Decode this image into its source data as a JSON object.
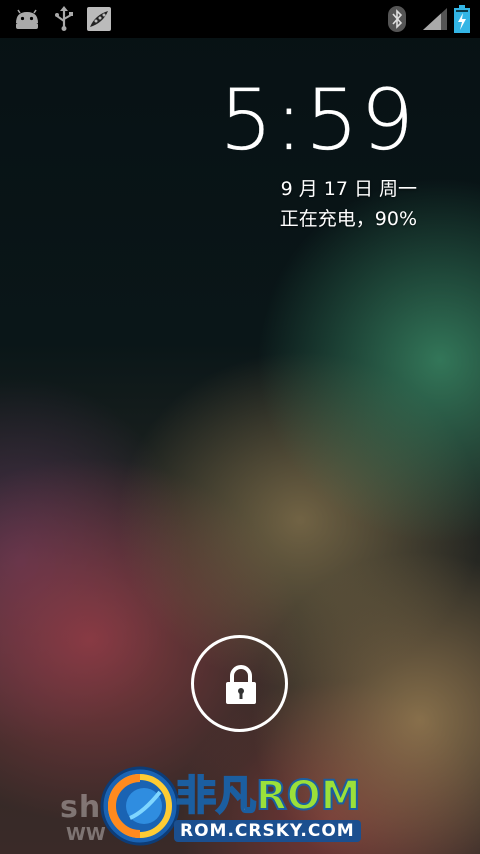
{
  "status_bar": {
    "left_icons": [
      "android-notification-icon",
      "usb-icon",
      "image-notification-icon"
    ],
    "right_icons": [
      "bluetooth-icon",
      "signal-icon",
      "battery-charging-icon"
    ]
  },
  "lockscreen": {
    "time": "5:59",
    "date": "9 月 17 日 周一",
    "charging_status": "正在充电，90%",
    "unlock_icon": "lock-icon"
  },
  "watermark": {
    "left_text": "sh",
    "left_url_fragment": "WW",
    "brand_cn": "非凡",
    "brand_en": "ROM",
    "url": "ROM.CRSKY.COM"
  },
  "colors": {
    "status_bar_bg": "#000000",
    "battery_accent": "#33b5e5",
    "brand_green": "#9be03a",
    "brand_blue": "#1b5ea0"
  }
}
